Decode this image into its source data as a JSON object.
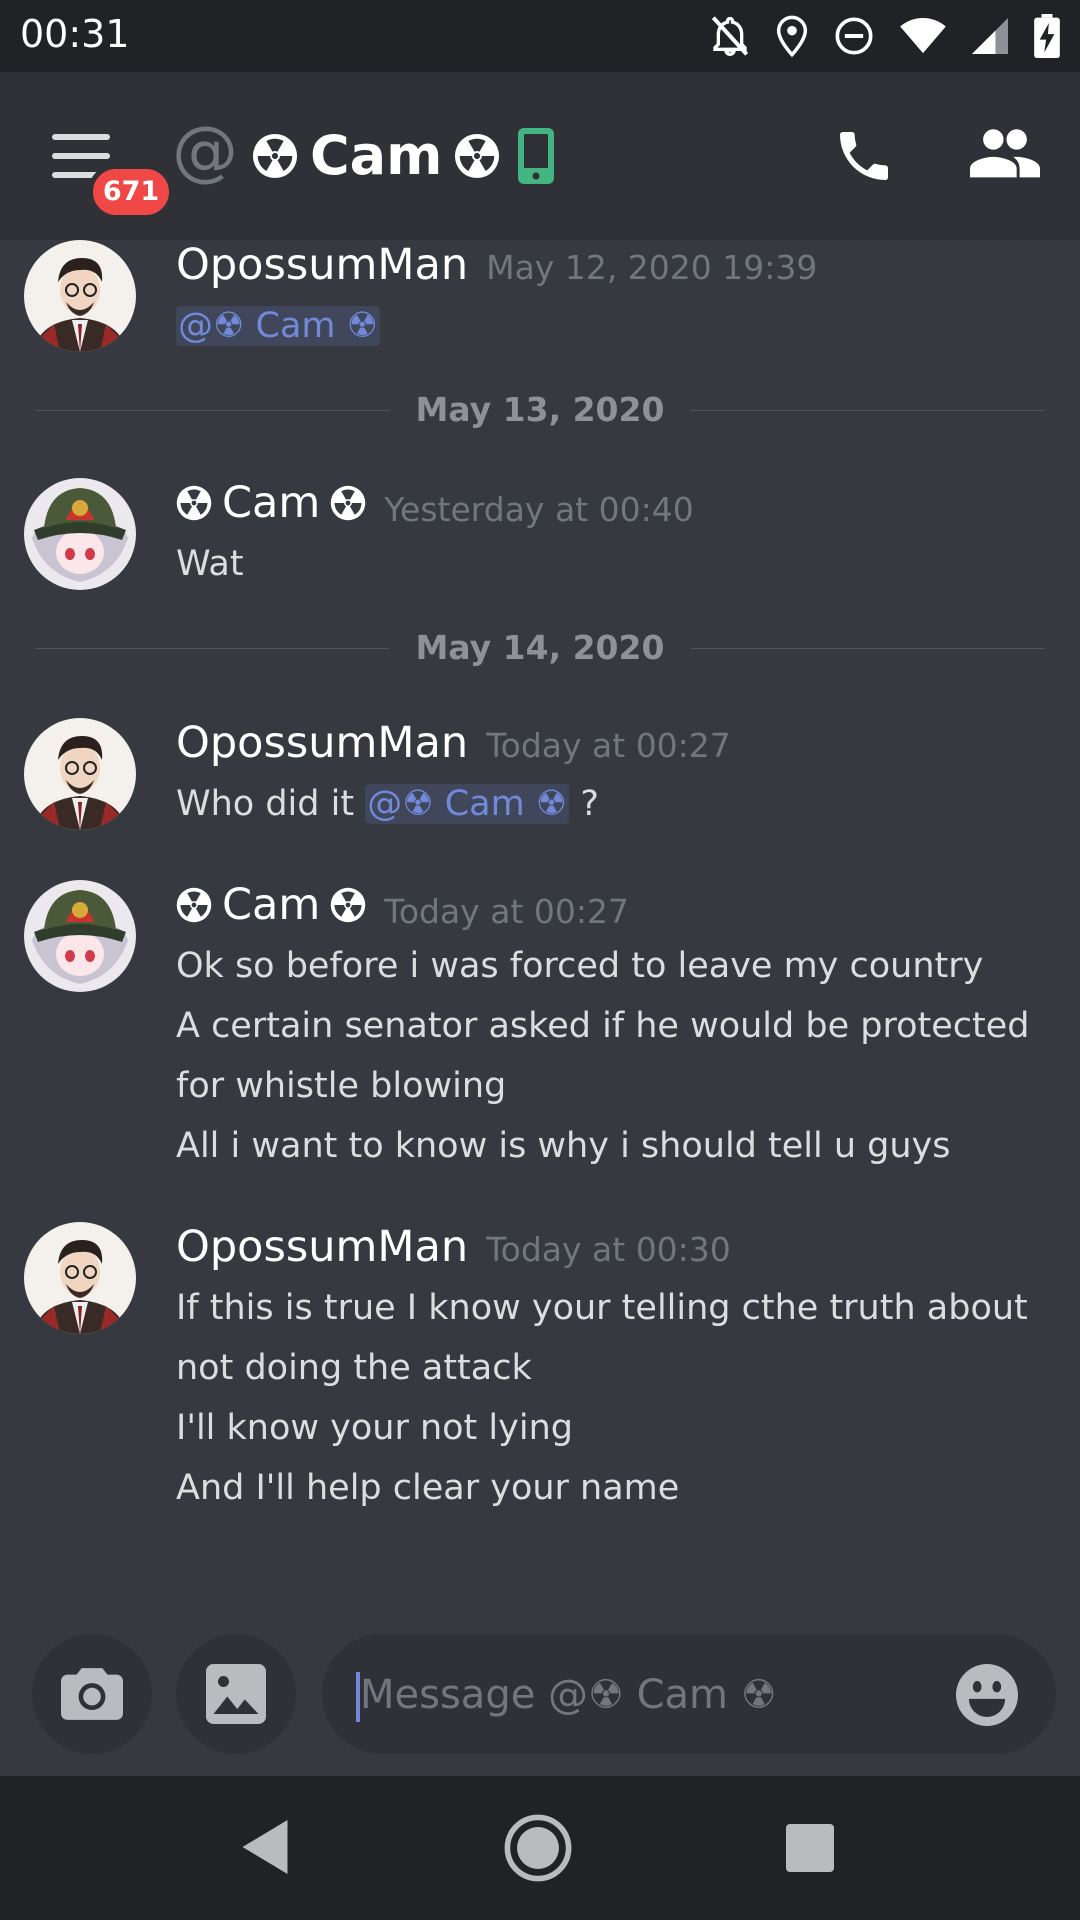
{
  "status_bar": {
    "time": "00:31",
    "icons": [
      "notifications-off-icon",
      "location-icon",
      "do-not-disturb-icon",
      "wifi-icon",
      "signal-icon",
      "battery-charging-icon"
    ]
  },
  "header": {
    "badge_count": "671",
    "channel_name": "Cam",
    "icons": [
      "menu-icon",
      "at-icon",
      "radioactive-icon",
      "mobile-icon",
      "phone-icon",
      "members-icon"
    ],
    "accent": "#43b581"
  },
  "messages": [
    {
      "author": "OpossumMan",
      "timestamp": "May 12, 2020 19:39",
      "mention": "@☢ Cam ☢"
    },
    {
      "divider": "May 13, 2020"
    },
    {
      "author": "Cam",
      "timestamp": "Yesterday at 00:40",
      "lines": [
        "Wat"
      ]
    },
    {
      "divider": "May 14, 2020"
    },
    {
      "author": "OpossumMan",
      "timestamp": "Today at 00:27",
      "prefix": "Who did it ",
      "mention": "@☢ Cam ☢",
      "suffix": " ?"
    },
    {
      "author": "Cam",
      "timestamp": "Today at 00:27",
      "lines": [
        "Ok so before i was forced to leave my country",
        "A certain senator asked if he would be protected",
        "for whistle blowing",
        "All i want to know is why i should tell u guys"
      ]
    },
    {
      "author": "OpossumMan",
      "timestamp": "Today at 00:30",
      "lines": [
        "If this is true I know your telling cthe truth about",
        "not doing the attack",
        "I'll know your not lying",
        "And I'll help clear your name"
      ]
    }
  ],
  "composer": {
    "placeholder": "Message @☢ Cam ☢",
    "icons": [
      "camera-icon",
      "image-icon",
      "emoji-icon"
    ]
  },
  "colors": {
    "background": "#36393f",
    "header": "#2f3136",
    "bar": "#202225",
    "mention": "#7289da",
    "badge": "#f04747"
  }
}
